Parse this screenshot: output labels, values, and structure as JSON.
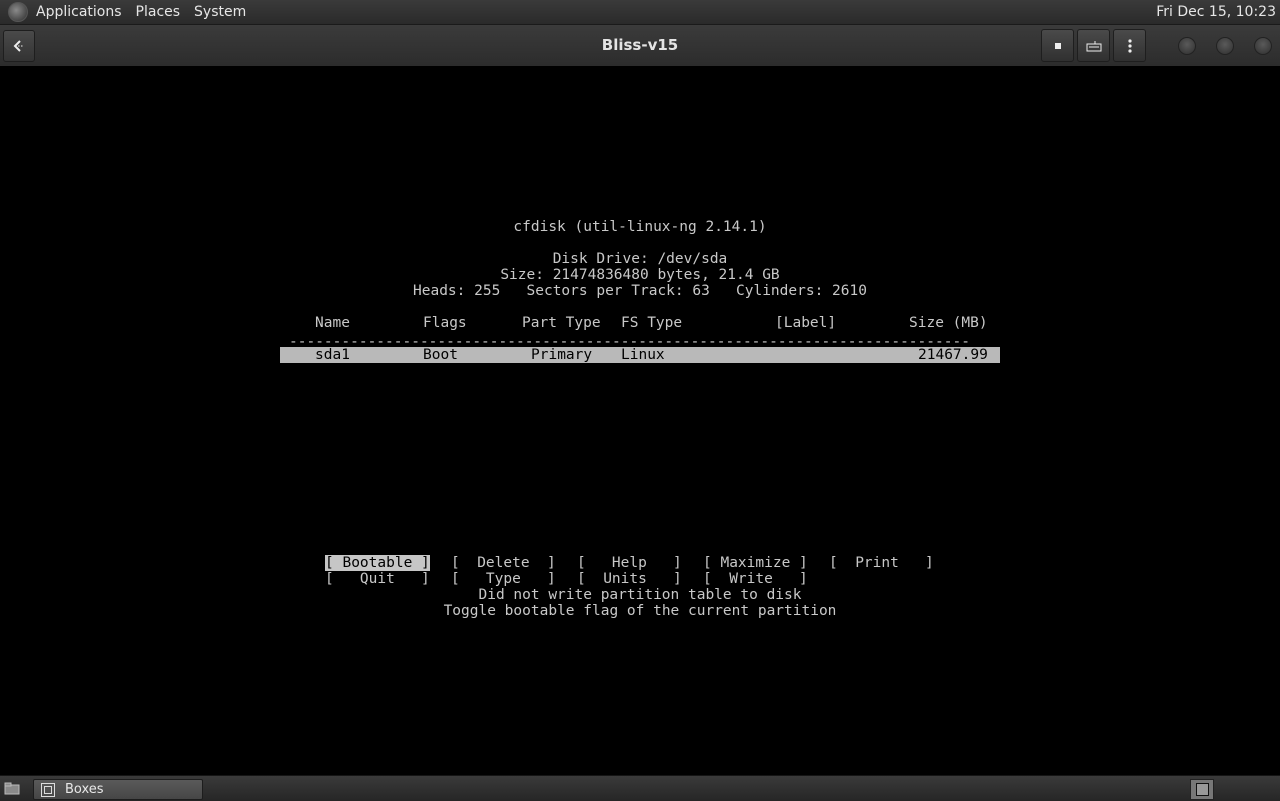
{
  "top_panel": {
    "menus": [
      "Applications",
      "Places",
      "System"
    ],
    "clock": "Fri Dec 15, 10:23"
  },
  "header": {
    "title": "Bliss-v15",
    "back_icon": "back-arrow-icon",
    "buttons": [
      "stop-icon",
      "keyboard-icon",
      "more-options-icon"
    ]
  },
  "terminal": {
    "program_title": "cfdisk (util-linux-ng 2.14.1)",
    "disk_drive": "Disk Drive: /dev/sda",
    "size_line": "Size: 21474836480 bytes, 21.4 GB",
    "geometry_line": "Heads: 255   Sectors per Track: 63   Cylinders: 2610",
    "table": {
      "headers": [
        "Name",
        "Flags",
        "Part Type",
        "FS Type",
        "[Label]",
        "Size (MB)"
      ],
      "separator": "------------------------------------------------------------------------------",
      "rows": [
        [
          "sda1",
          "Boot",
          "Primary",
          "Linux",
          "",
          "21467.99"
        ]
      ]
    },
    "menu_row1": [
      "[ Bootable ]",
      "[  Delete  ]",
      "[   Help   ]",
      "[ Maximize ]",
      "[  Print   ]"
    ],
    "menu_row2": [
      "[   Quit   ]",
      "[   Type   ]",
      "[  Units   ]",
      "[  Write   ]"
    ],
    "status_message": "Did not write partition table to disk",
    "help_message": "Toggle bootable flag of the current partition"
  },
  "taskbar": {
    "show_desktop_icon": "show-desktop-icon",
    "task_label": "Boxes",
    "workspace_icon": "workspace-switcher-icon"
  }
}
